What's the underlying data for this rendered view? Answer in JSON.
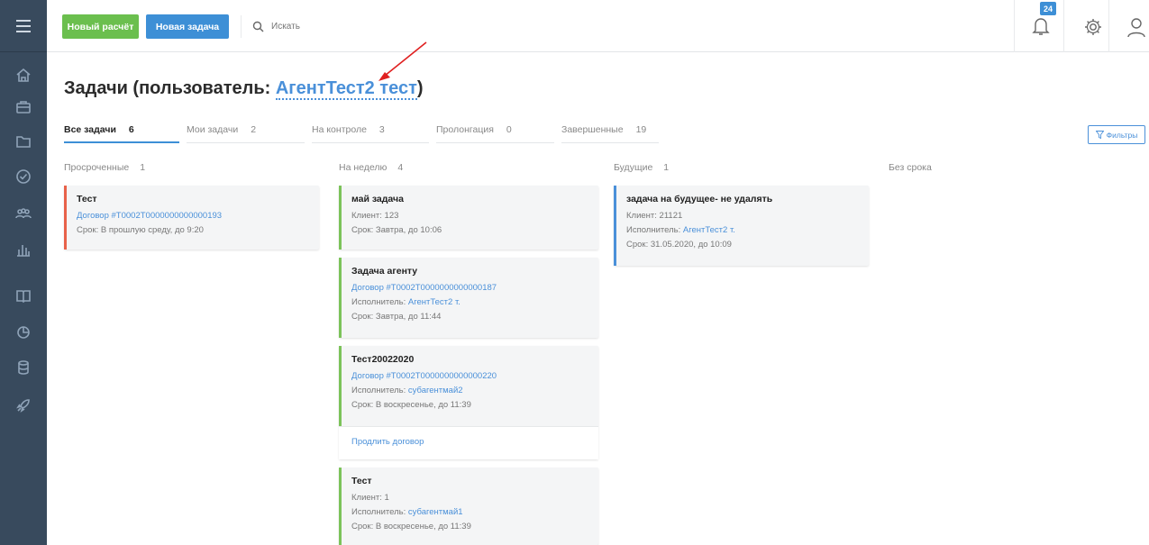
{
  "topbar": {
    "new_calc_label": "Новый расчёт",
    "new_task_label": "Новая задача",
    "search_placeholder": "Искать",
    "notifications_count": "24"
  },
  "page": {
    "title_prefix": "Задачи (пользователь: ",
    "user_name": "АгентТест2 тест",
    "title_suffix": ")"
  },
  "tabs": [
    {
      "label": "Все задачи",
      "count": "6"
    },
    {
      "label": "Мои задачи",
      "count": "2"
    },
    {
      "label": "На контроле",
      "count": "3"
    },
    {
      "label": "Пролонгация",
      "count": "0"
    },
    {
      "label": "Завершенные",
      "count": "19"
    }
  ],
  "filters_label": "Фильтры",
  "columns": [
    {
      "label": "Просроченные",
      "count": "1"
    },
    {
      "label": "На неделю",
      "count": "4"
    },
    {
      "label": "Будущие",
      "count": "1"
    },
    {
      "label": "Без срока"
    }
  ],
  "cards": {
    "overdue": [
      {
        "title": "Тест",
        "contract": "Договор #Т0002Т0000000000000193",
        "due": "Срок: В прошлую среду, до 9:20"
      }
    ],
    "week": [
      {
        "title": "май задача",
        "client": "Клиент: 123",
        "due": "Срок: Завтра, до 10:06"
      },
      {
        "title": "Задача агенту",
        "contract": "Договор #Т0002Т0000000000000187",
        "executor_label": "Исполнитель: ",
        "executor": "АгентТест2 т.",
        "due": "Срок: Завтра, до 11:44"
      },
      {
        "title": "Тест20022020",
        "contract": "Договор #Т0002Т0000000000000220",
        "executor_label": "Исполнитель: ",
        "executor": "субагентмай2",
        "due": "Срок: В воскресенье, до 11:39",
        "action": "Продлить договор"
      },
      {
        "title": "Тест",
        "client": "Клиент: 1",
        "executor_label": "Исполнитель: ",
        "executor": "субагентмай1",
        "due": "Срок: В воскресенье, до 11:39"
      }
    ],
    "future": [
      {
        "title": "задача на будущее- не удалять",
        "client": "Клиент: 21121",
        "executor_label": "Исполнитель: ",
        "executor": "АгентТест2 т.",
        "due": "Срок: 31.05.2020, до 10:09"
      }
    ]
  },
  "colors": {
    "sidebar": "#384a5d",
    "accent_blue": "#3d8fd6",
    "accent_green": "#6bbf4e",
    "overdue_red": "#e8624a"
  },
  "icons": [
    "menu-icon",
    "home-icon",
    "briefcase-icon",
    "folder-icon",
    "check-circle-icon",
    "users-icon",
    "chart-icon",
    "book-icon",
    "pie-chart-icon",
    "database-icon",
    "rocket-icon",
    "search-icon",
    "bell-icon",
    "gear-icon",
    "user-icon",
    "funnel-icon"
  ]
}
